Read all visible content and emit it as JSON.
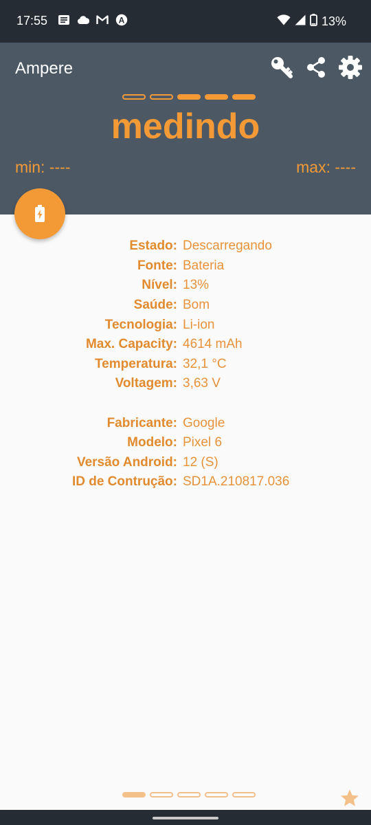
{
  "status_bar": {
    "time": "17:55",
    "battery_percent": "13%",
    "icons": [
      "news-icon",
      "cloud-icon",
      "gmail-icon",
      "a-badge-icon",
      "wifi-icon",
      "signal-icon",
      "battery-icon"
    ]
  },
  "app": {
    "title": "Ampere"
  },
  "toolbar": {
    "icons": [
      "key-icon",
      "share-icon",
      "gear-icon"
    ]
  },
  "pager_top": {
    "total": 5,
    "filled": [
      2,
      3,
      4
    ]
  },
  "measure": {
    "status": "medindo",
    "min": "min: ----",
    "max": "max: ----"
  },
  "fab": {
    "icon": "battery-charging-icon"
  },
  "battery_info": [
    {
      "label": "Estado:",
      "value": "Descarregando"
    },
    {
      "label": "Fonte:",
      "value": "Bateria"
    },
    {
      "label": "Nível:",
      "value": "13%"
    },
    {
      "label": "Saúde:",
      "value": "Bom"
    },
    {
      "label": "Tecnologia:",
      "value": "Li-ion"
    },
    {
      "label": "Max. Capacity:",
      "value": "4614 mAh"
    },
    {
      "label": "Temperatura:",
      "value": "32,1 °C"
    },
    {
      "label": "Voltagem:",
      "value": "3,63 V"
    }
  ],
  "device_info": [
    {
      "label": "Fabricante:",
      "value": "Google"
    },
    {
      "label": "Modelo:",
      "value": "Pixel 6"
    },
    {
      "label": "Versão Android:",
      "value": "12 (S)"
    },
    {
      "label": "ID de Contrução:",
      "value": "SD1A.210817.036"
    }
  ],
  "pager_bottom": {
    "total": 5,
    "filled": [
      0
    ]
  },
  "colors": {
    "accent": "#f39a37",
    "appbar": "#4c5964",
    "statusbar": "#252c33",
    "background": "#fafafa"
  }
}
